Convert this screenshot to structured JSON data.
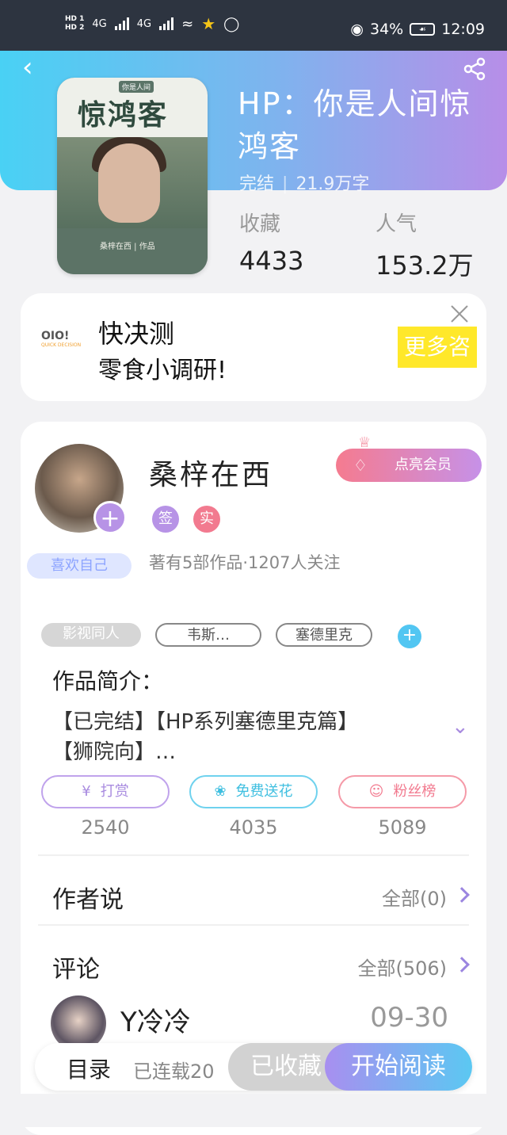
{
  "status_bar": {
    "sim1": "HD 1",
    "sim2": "HD 2",
    "net1": "4G",
    "net2": "4G",
    "battery": "34%",
    "time": "12:09"
  },
  "header": {
    "back_icon": "chevron-left-icon",
    "share_icon": "share-icon"
  },
  "book": {
    "cover_title": "惊鸿客",
    "cover_subtitle": "你是人间",
    "cover_author": "桑梓在西 | 作品",
    "title": "HP：你是人间惊鸿客",
    "status": "完结",
    "word_count": "21.9万字",
    "favorites_label": "收藏",
    "favorites_value": "4433",
    "popularity_label": "人气",
    "popularity_value": "153.2万"
  },
  "ad": {
    "logo_text": "OIO!",
    "logo_sub": "QUICK DECISION",
    "line1": "快决测",
    "line2": "零食小调研!",
    "button": "更多咨",
    "close_icon": "close-icon"
  },
  "author": {
    "name": "桑梓在西",
    "badge_signed": "签",
    "badge_real": "实",
    "like_tag": "喜欢自己",
    "info": "著有5部作品·1207人关注",
    "vip_button": "点亮会员",
    "vip_icon": "diamond-icon",
    "crown_icon": "crown-icon"
  },
  "tags": [
    "影视同人",
    "韦斯…",
    "塞德里克"
  ],
  "intro": {
    "label": "作品简介：",
    "line1": "【已完结】【HP系列塞德里克篇】",
    "line2": "【狮院向】…"
  },
  "actions": [
    {
      "label": "打赏",
      "count": "2540",
      "icon": "yen-icon",
      "color": "#b793e6"
    },
    {
      "label": "免费送花",
      "count": "4035",
      "icon": "flower-icon",
      "color": "#4dc8e8"
    },
    {
      "label": "粉丝榜",
      "count": "5089",
      "icon": "fans-icon",
      "color": "#f27a8f"
    }
  ],
  "author_say": {
    "title": "作者说",
    "more": "全部(0)"
  },
  "comments": {
    "title": "评论",
    "more": "全部(506)",
    "first": {
      "user": "Y冷冷",
      "date": "09-30"
    }
  },
  "bottom_bar": {
    "toc": "目录",
    "serial": "已连载20",
    "favorite": "已收藏",
    "read": "开始阅读"
  }
}
